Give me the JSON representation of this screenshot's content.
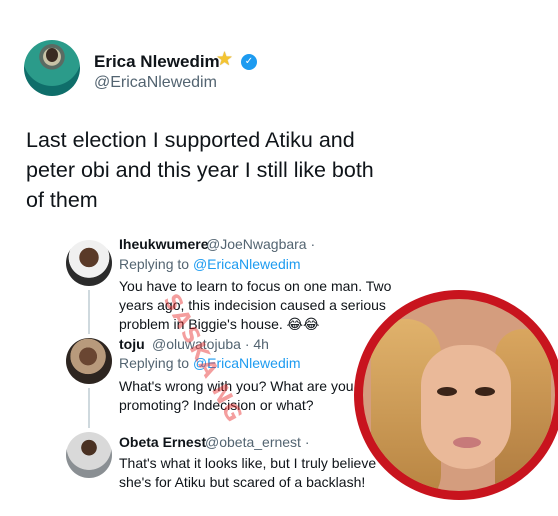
{
  "author": {
    "name": "Erica Nlewedim",
    "handle": "@EricaNlewedim",
    "star_icon": "star-icon",
    "verified_icon": "verified-badge-icon"
  },
  "tweet": {
    "text_line1": "Last election I supported Atiku and",
    "text_line2": "peter obi and this year I still like both",
    "text_line3": "of them"
  },
  "replies": [
    {
      "name": "Iheukwumere",
      "handle": "@JoeNwagbara ·",
      "replying_prefix": "Replying to ",
      "replying_to": "@EricaNlewedim",
      "line1": "You have to learn to focus on one man. Two",
      "line2": "years ago, this indecision caused a serious",
      "line3": "problem in Biggie's house. 😂😂"
    },
    {
      "name": "toju",
      "handle": "@oluwatojuba · 4h",
      "replying_prefix": "Replying to ",
      "replying_to": "@EricaNlewedim",
      "line1": "What's wrong with you? What are you",
      "line2": "promoting? Indecision or what?"
    },
    {
      "name": "Obeta Ernest",
      "handle": "@obeta_ernest ·",
      "line1": "That's what it looks like, but I truly believe",
      "line2": "she's for Atiku but scared of a backlash!"
    }
  ],
  "watermark": "SASKA NG",
  "colors": {
    "link": "#1d9bf0",
    "inset_border": "#c8141e",
    "star": "#f4c430"
  }
}
